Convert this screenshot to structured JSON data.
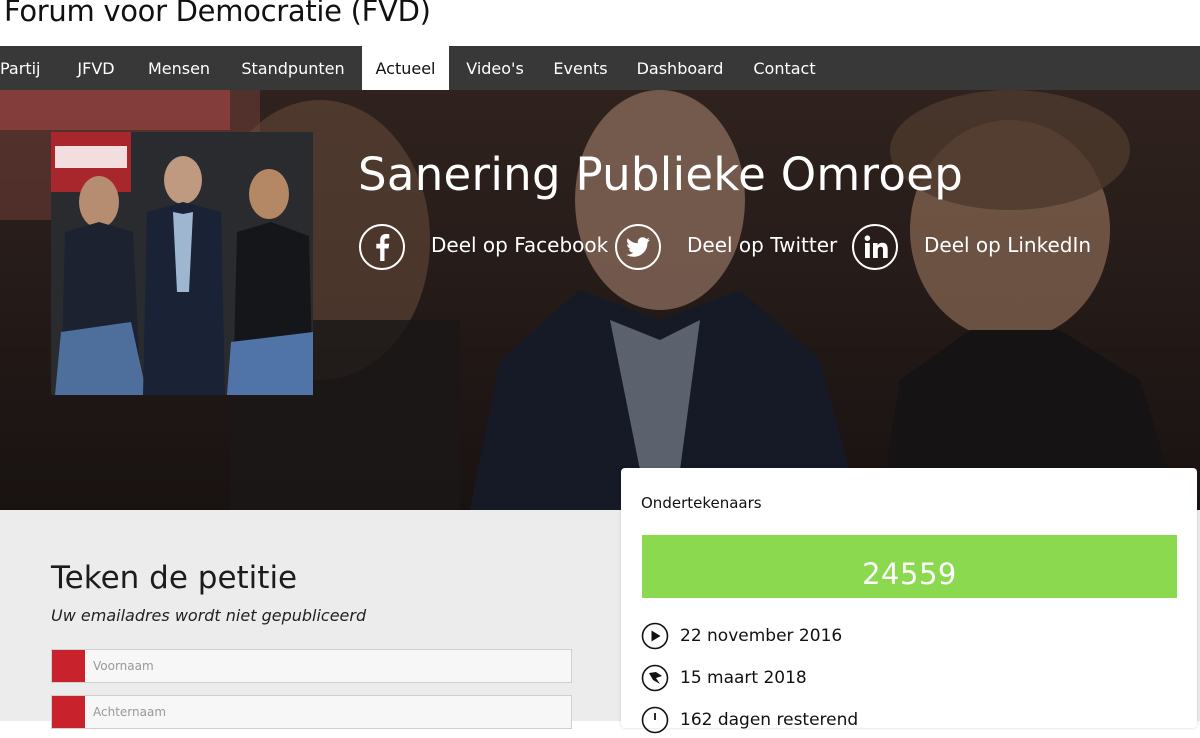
{
  "site": {
    "title": "Forum voor Democratie (FVD)"
  },
  "nav": {
    "items": [
      {
        "label": "Partij"
      },
      {
        "label": "JFVD"
      },
      {
        "label": "Mensen"
      },
      {
        "label": "Standpunten"
      },
      {
        "label": "Actueel",
        "active": true
      },
      {
        "label": "Video's"
      },
      {
        "label": "Events"
      },
      {
        "label": "Dashboard"
      },
      {
        "label": "Contact"
      }
    ]
  },
  "hero": {
    "title": "Sanering Publieke Omroep",
    "share": [
      {
        "icon": "facebook-icon",
        "label": "Deel op Facebook"
      },
      {
        "icon": "twitter-icon",
        "label": "Deel op Twitter"
      },
      {
        "icon": "linkedin-icon",
        "label": "Deel op LinkedIn"
      }
    ]
  },
  "petition": {
    "title": "Teken de petitie",
    "note": "Uw emailadres wordt niet gepubliceerd",
    "fields": [
      {
        "placeholder": "Voornaam"
      },
      {
        "placeholder": "Achternaam"
      }
    ]
  },
  "signers": {
    "title": "Ondertekenaars",
    "count": "24559",
    "start_date": "22 november 2016",
    "end_date": "15 maart 2018",
    "remaining": "162 dagen resterend"
  },
  "colors": {
    "navbar": "#383838",
    "counter": "#8bd94e",
    "required": "#c8232c"
  }
}
